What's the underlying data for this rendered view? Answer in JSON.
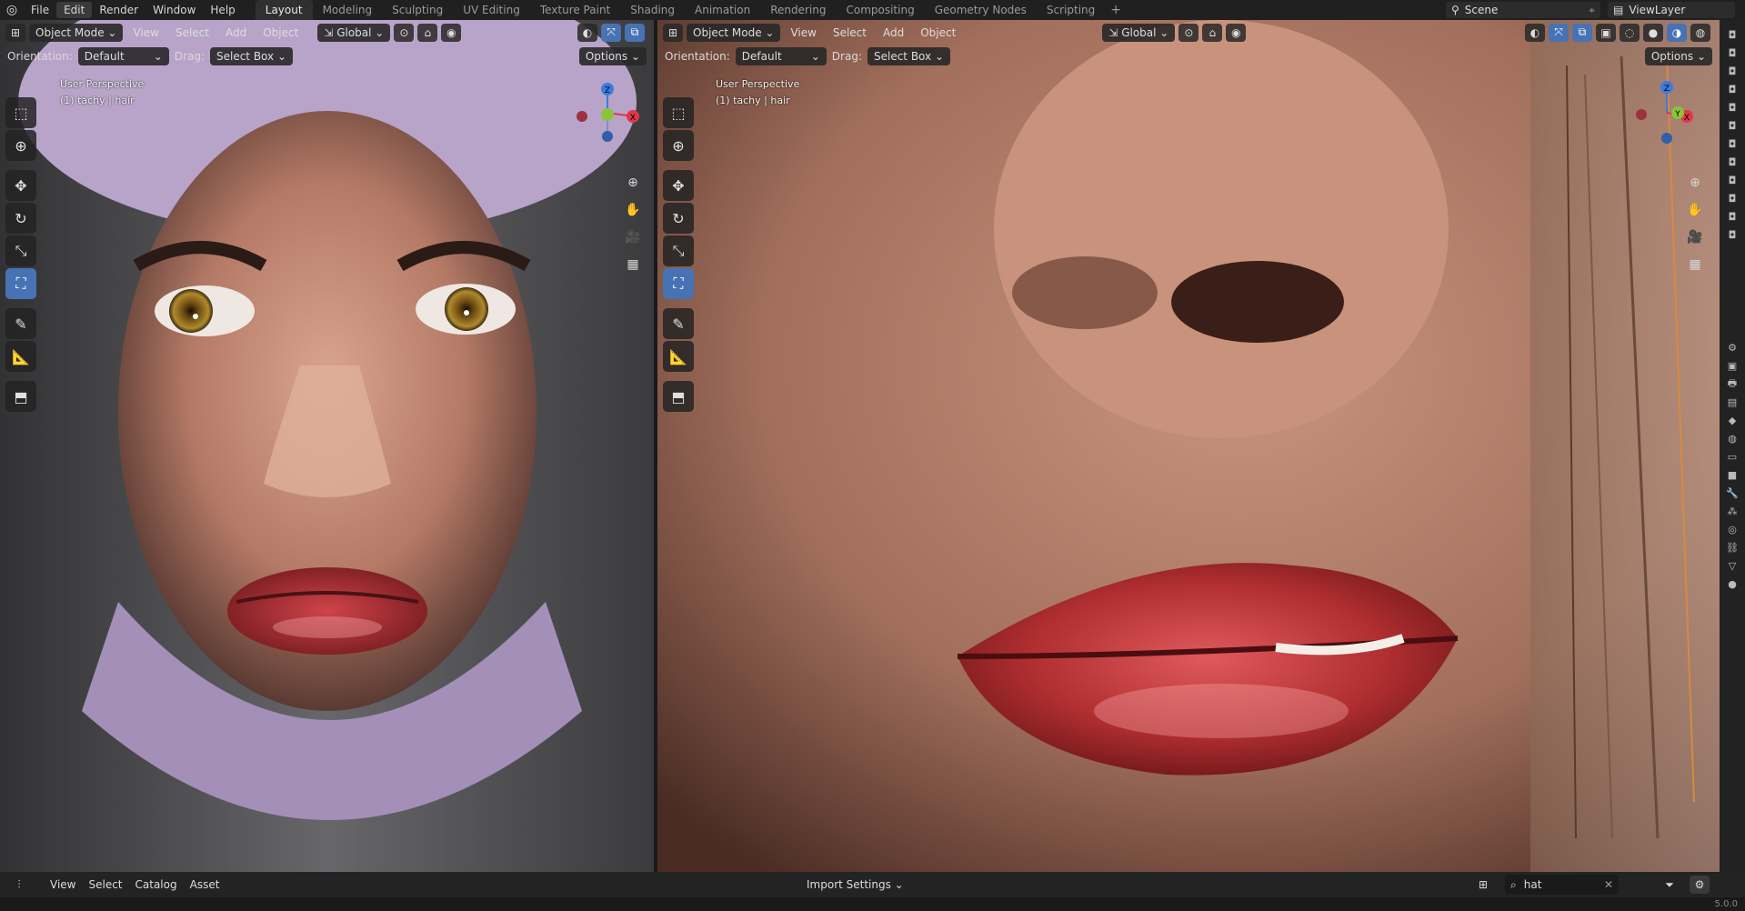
{
  "topbar": {
    "menus": [
      "File",
      "Edit",
      "Render",
      "Window",
      "Help"
    ],
    "workspaces": [
      "Layout",
      "Modeling",
      "Sculpting",
      "UV Editing",
      "Texture Paint",
      "Shading",
      "Animation",
      "Rendering",
      "Compositing",
      "Geometry Nodes",
      "Scripting"
    ],
    "active_workspace": "Layout",
    "scene_name": "Scene",
    "view_layer": "ViewLayer"
  },
  "viewport_left": {
    "mode": "Object Mode",
    "menus": [
      "View",
      "Select",
      "Add",
      "Object"
    ],
    "transform": "Global",
    "orientation_label": "Orientation:",
    "orientation_value": "Default",
    "drag_label": "Drag:",
    "drag_value": "Select Box",
    "options_label": "Options",
    "perspective": "User Perspective",
    "object_info": "(1) tachy | hair"
  },
  "viewport_right": {
    "mode": "Object Mode",
    "menus": [
      "View",
      "Select",
      "Add",
      "Object"
    ],
    "transform": "Global",
    "orientation_label": "Orientation:",
    "orientation_value": "Default",
    "drag_label": "Drag:",
    "drag_value": "Select Box",
    "options_label": "Options",
    "perspective": "User Perspective",
    "object_info": "(1) tachy | hair"
  },
  "gizmo_axes": {
    "x": "X",
    "y": "Y",
    "z": "Z"
  },
  "asset_browser": {
    "menus": [
      "View",
      "Select",
      "Catalog",
      "Asset"
    ],
    "import_settings": "Import Settings",
    "search_value": "hat"
  },
  "status": {
    "version": "5.0.0"
  },
  "colors": {
    "accent_blue": "#4772b3",
    "axis_x": "#e0364a",
    "axis_y": "#8ac43b",
    "axis_z": "#3c7be0"
  }
}
